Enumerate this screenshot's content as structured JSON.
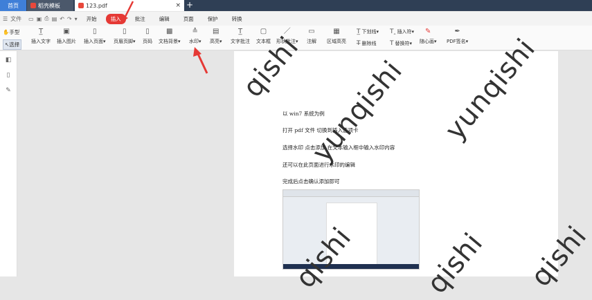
{
  "titlebar": {
    "home_tab": "首页",
    "tabs": [
      {
        "label": "稻壳模板",
        "icon": "daoke-icon",
        "color": "#e8483b"
      },
      {
        "label": "123.pdf",
        "icon": "pdf-file-icon",
        "color": "#e8483b"
      }
    ],
    "tab_close": "×",
    "add_tab": "+"
  },
  "menubar": {
    "file_label": "文件",
    "items": [
      {
        "label": "开始"
      },
      {
        "label": "插入",
        "active": true
      },
      {
        "label": "批注"
      },
      {
        "label": "编辑"
      },
      {
        "label": "页面"
      },
      {
        "label": "保护"
      },
      {
        "label": "转换"
      }
    ]
  },
  "toolbar": {
    "hand_label": "手型",
    "select_label": "选择",
    "buttons": [
      {
        "label": "插入文字",
        "icon": "insert-text-icon",
        "glyph": "T̲"
      },
      {
        "label": "插入图片",
        "icon": "insert-image-icon",
        "glyph": "▣"
      },
      {
        "label": "插入页面▾",
        "icon": "insert-page-icon",
        "glyph": "▯"
      },
      {
        "label": "页眉页脚▾",
        "icon": "header-footer-icon",
        "glyph": "▯"
      },
      {
        "label": "页码",
        "icon": "page-number-icon",
        "glyph": "▯"
      },
      {
        "label": "文档背景▾",
        "icon": "background-icon",
        "glyph": "▩"
      },
      {
        "label": "水印▾",
        "icon": "watermark-icon",
        "glyph": "≙"
      },
      {
        "label": "高亮▾",
        "icon": "highlight-icon",
        "glyph": "▤"
      },
      {
        "label": "文字批注",
        "icon": "text-comment-icon",
        "glyph": "T̲"
      },
      {
        "label": "文本框",
        "icon": "textbox-icon",
        "glyph": "▢"
      },
      {
        "label": "形状批注▾",
        "icon": "shape-comment-icon",
        "glyph": "／"
      },
      {
        "label": "注解",
        "icon": "note-icon",
        "glyph": "▭"
      },
      {
        "label": "区域高亮",
        "icon": "area-highlight-icon",
        "glyph": "▦"
      }
    ],
    "right_buttons": [
      {
        "label": "下划线▾",
        "icon": "underline-icon",
        "glyph": "T̲"
      },
      {
        "label": "删除线",
        "icon": "strikethrough-icon",
        "glyph": "T̶"
      },
      {
        "label": "插入符▾",
        "icon": "insert-symbol-icon",
        "glyph": "T‸"
      },
      {
        "label": "替换符▾",
        "icon": "replace-symbol-icon",
        "glyph": "T"
      },
      {
        "label": "随心画▾",
        "icon": "freehand-icon",
        "glyph": "✎"
      },
      {
        "label": "PDF签名▾",
        "icon": "pdf-sign-icon",
        "glyph": "✒"
      }
    ]
  },
  "document": {
    "lines": [
      "以 win7 系统为例",
      "打开 pdf 文件    切换到插入选项卡",
      "选择水印     点击添加    在文本输入框中输入水印内容",
      "还可以在此页面进行水印的编辑",
      "完成后点击确认添加即可"
    ],
    "watermark": "yunqishi",
    "watermark_partial_1": "qishi",
    "watermark_partial_2": "qishi"
  },
  "colors": {
    "accent": "#e53935",
    "titlebar": "#2f3f55",
    "home_tab": "#3f7fd8"
  }
}
